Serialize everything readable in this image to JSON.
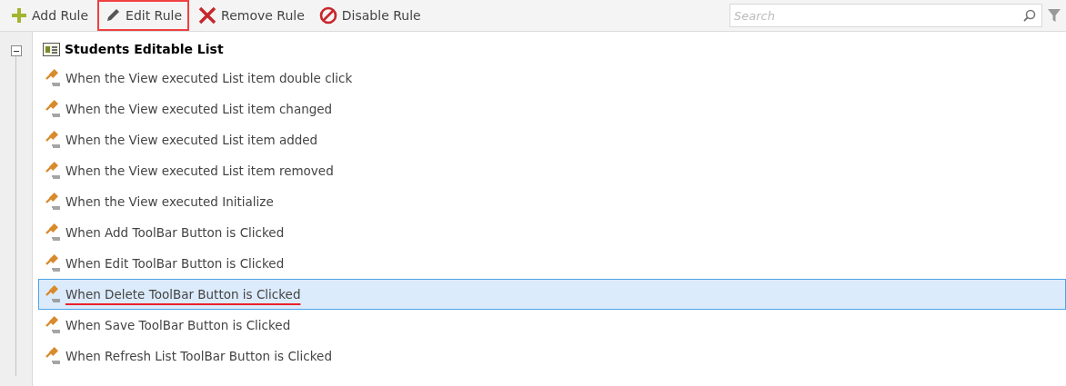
{
  "toolbar": {
    "buttons": [
      {
        "kind": "add",
        "label": "Add Rule",
        "highlighted": false
      },
      {
        "kind": "edit",
        "label": "Edit Rule",
        "highlighted": true
      },
      {
        "kind": "remove",
        "label": "Remove Rule",
        "highlighted": false
      },
      {
        "kind": "disable",
        "label": "Disable Rule",
        "highlighted": false
      }
    ],
    "search": {
      "placeholder": "Search"
    }
  },
  "tree": {
    "expanded": true,
    "title": "Students Editable List",
    "rules": [
      {
        "label": "When the View executed List item double click",
        "selected": false,
        "underlined": false
      },
      {
        "label": "When the View executed List item changed",
        "selected": false,
        "underlined": false
      },
      {
        "label": "When the View executed List item added",
        "selected": false,
        "underlined": false
      },
      {
        "label": "When the View executed List item removed",
        "selected": false,
        "underlined": false
      },
      {
        "label": "When the View executed Initialize",
        "selected": false,
        "underlined": false
      },
      {
        "label": "When Add ToolBar Button is Clicked",
        "selected": false,
        "underlined": false
      },
      {
        "label": "When Edit ToolBar Button is Clicked",
        "selected": false,
        "underlined": false
      },
      {
        "label": "When Delete ToolBar Button is Clicked",
        "selected": true,
        "underlined": true
      },
      {
        "label": "When Save ToolBar Button is Clicked",
        "selected": false,
        "underlined": false
      },
      {
        "label": "When Refresh List ToolBar Button is Clicked",
        "selected": false,
        "underlined": false
      }
    ]
  }
}
